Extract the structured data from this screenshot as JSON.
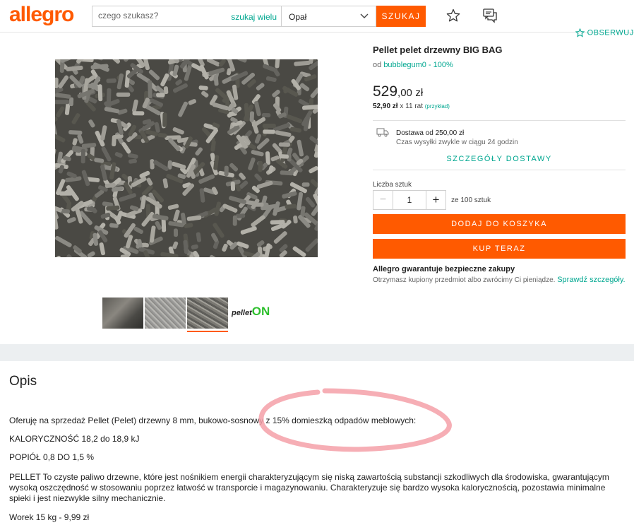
{
  "header": {
    "logo": "allegro",
    "search_placeholder": "czego szukasz?",
    "search_many": "szukaj wielu",
    "category": "Opał",
    "search_button": "SZUKAJ",
    "observe": "OBSERWUJ"
  },
  "product": {
    "title": "Pellet pelet drzewny BIG BAG",
    "seller_prefix": "od",
    "seller": "bubblegum0 - 100%",
    "price_main": "529",
    "price_cents": ",00",
    "price_currency": "zł",
    "installment_amount": "52,90 zł",
    "installment_text": "x 11 rat",
    "installment_example": "(przykład)"
  },
  "delivery": {
    "line1": "Dostawa od 250,00 zł",
    "line2": "Czas wysyłki zwykle w ciągu 24 godzin",
    "details_link": "SZCZEGÓŁY DOSTAWY"
  },
  "quantity": {
    "label": "Liczba sztuk",
    "minus": "−",
    "value": "1",
    "plus": "+",
    "of_text": "ze 100 sztuk"
  },
  "buttons": {
    "add_to_cart": "DODAJ DO KOSZYKA",
    "buy_now": "KUP TERAZ"
  },
  "guarantee": {
    "title": "Allegro gwarantuje bezpieczne zakupy",
    "text": "Otrzymasz kupiony przedmiot albo zwrócimy Ci pieniądze.",
    "link": "Sprawdź szczegóły."
  },
  "thumbnails": {
    "logo_text": "pellet",
    "logo_on": "ON"
  },
  "description": {
    "title": "Opis",
    "p1": "Oferuję na sprzedaż Pellet (Pelet) drzewny 8 mm, bukowo-sosnowy z 15% domieszką odpadów meblowych:",
    "p2": "KALORYCZNOŚĆ 18,2 do 18,9 kJ",
    "p3": "POPIÓŁ 0,8 DO 1,5 %",
    "p4": "PELLET To czyste paliwo drzewne, które jest nośnikiem energii charakteryzującym się niską zawartością substancji szkodliwych dla środowiska, gwarantującym wysoką oszczędność w stosowaniu poprzez łatwość w transporcie i magazynowaniu. Charakteryzuje się bardzo wysoka kalorycznością, pozostawia minimalne spieki i jest niezwykle silny mechanicznie.",
    "p5": "Worek 15 kg - 9,99 zł"
  },
  "colors": {
    "brand": "#ff5a00",
    "link": "#00a790",
    "annotation": "#f4a0a8"
  }
}
